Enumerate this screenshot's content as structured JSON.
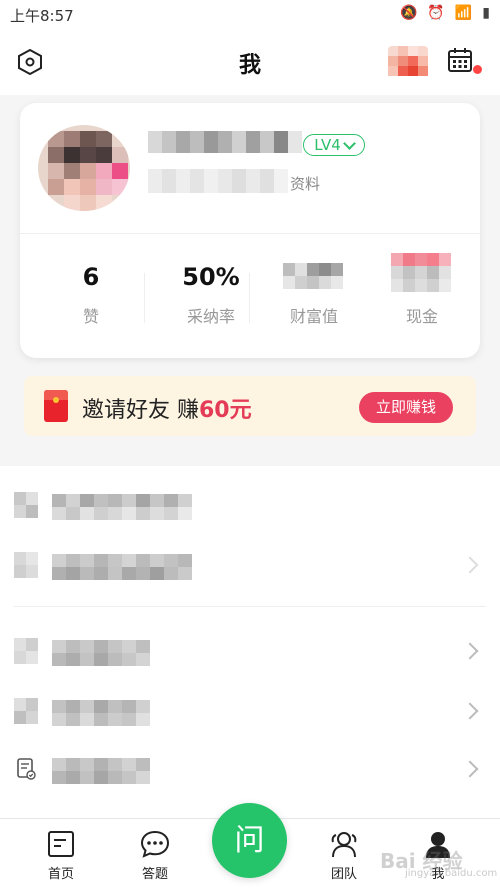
{
  "status_bar": {
    "time": "上午8:57"
  },
  "header": {
    "title": "我"
  },
  "profile": {
    "level": "LV4",
    "profile_link": "资料",
    "stats": [
      {
        "value": "6",
        "label": "赞"
      },
      {
        "value": "50%",
        "label": "采纳率"
      },
      {
        "value": "",
        "label": "财富值"
      },
      {
        "value": "",
        "label": "现金"
      }
    ]
  },
  "invite": {
    "text": "邀请好友 赚",
    "amount": "60元",
    "button": "立即赚钱"
  },
  "tabs": [
    {
      "label": "首页"
    },
    {
      "label": "答题"
    },
    {
      "label": "问"
    },
    {
      "label": "团队"
    },
    {
      "label": "我"
    }
  ],
  "watermark": {
    "text": "Bai 经验",
    "sub": "jingyan.baidu.com"
  },
  "colors": {
    "accent": "#25c46a",
    "level": "#2bbf6a",
    "invite_amount": "#e43c57",
    "earn_button": "#ea4160",
    "badge": "#ff4444"
  }
}
